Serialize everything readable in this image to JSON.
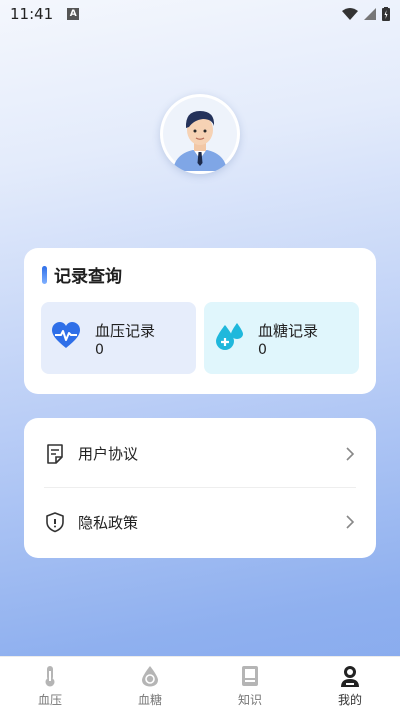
{
  "status_bar": {
    "time": "11:41",
    "notification_letter": "A"
  },
  "records_card": {
    "title": "记录查询",
    "blood_pressure": {
      "label": "血压记录",
      "value": "0"
    },
    "blood_sugar": {
      "label": "血糖记录",
      "value": "0"
    }
  },
  "menu": {
    "items": [
      {
        "label": "用户协议",
        "icon": "document-icon"
      },
      {
        "label": "隐私政策",
        "icon": "shield-icon"
      }
    ]
  },
  "tabs": [
    {
      "label": "血压",
      "icon": "thermometer-icon",
      "active": false
    },
    {
      "label": "血糖",
      "icon": "blood-drop-icon",
      "active": false
    },
    {
      "label": "知识",
      "icon": "book-icon",
      "active": false
    },
    {
      "label": "我的",
      "icon": "person-icon",
      "active": true
    }
  ],
  "colors": {
    "accent": "#2f6fe8",
    "blood_pressure_tile": "#e6edfb",
    "blood_sugar_tile": "#e0f6fc",
    "blood_sugar_icon": "#1fb8dc"
  }
}
